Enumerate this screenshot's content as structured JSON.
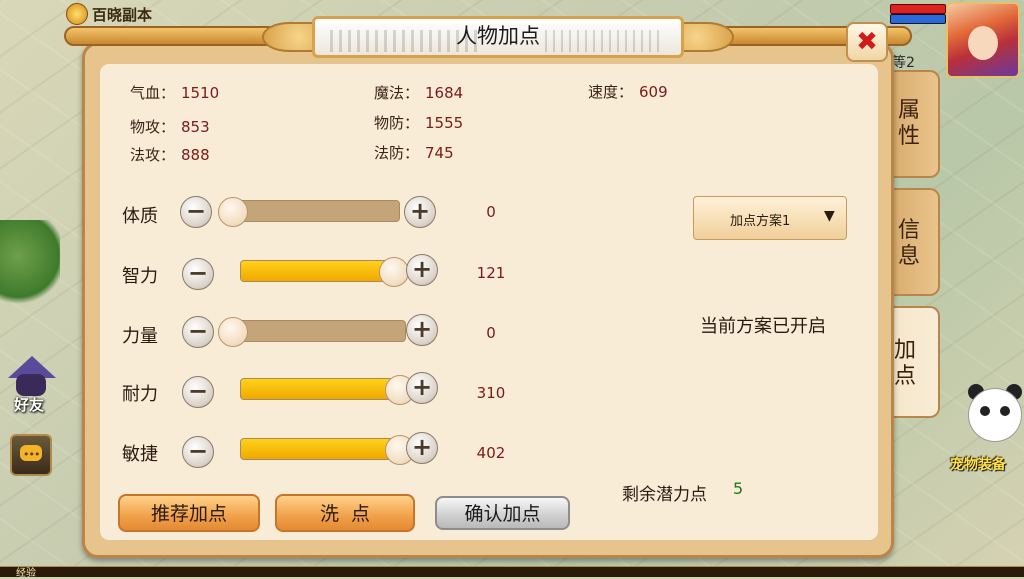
{
  "hud": {
    "dungeon_label": "百晓副本",
    "level": "等2",
    "friend_label": "好友",
    "pet_label": "宠物装备",
    "exp_label": "经验"
  },
  "panel": {
    "title": "人物加点",
    "close_icon": "close-x-icon"
  },
  "stats": {
    "hp_label": "气血：",
    "hp": "1510",
    "mp_label": "魔法：",
    "mp": "1684",
    "speed_label": "速度：",
    "speed": "609",
    "patk_label": "物攻：",
    "patk": "853",
    "pdef_label": "物防：",
    "pdef": "1555",
    "matk_label": "法攻：",
    "matk": "888",
    "mdef_label": "法防：",
    "mdef": "745"
  },
  "attributes": [
    {
      "label": "体质",
      "value": "0",
      "fill": 0.0
    },
    {
      "label": "智力",
      "value": "121",
      "fill": 1.0
    },
    {
      "label": "力量",
      "value": "0",
      "fill": 0.0
    },
    {
      "label": "耐力",
      "value": "310",
      "fill": 1.0
    },
    {
      "label": "敏捷",
      "value": "402",
      "fill": 1.0
    }
  ],
  "plan": {
    "selected": "加点方案1",
    "status": "当前方案已开启"
  },
  "remaining": {
    "label": "剩余潜力点",
    "value": "5"
  },
  "buttons": {
    "recommend": "推荐加点",
    "reset": "洗  点",
    "confirm": "确认加点"
  },
  "tabs": [
    {
      "label": "属\n性",
      "active": false
    },
    {
      "label": "信\n息",
      "active": false
    },
    {
      "label": "加\n点",
      "active": true
    }
  ],
  "colors": {
    "slider_fill": "#f0a800",
    "value_red": "#7a1a1a",
    "remaining_green": "#1a7a1a",
    "close_red": "#d21a1a"
  }
}
